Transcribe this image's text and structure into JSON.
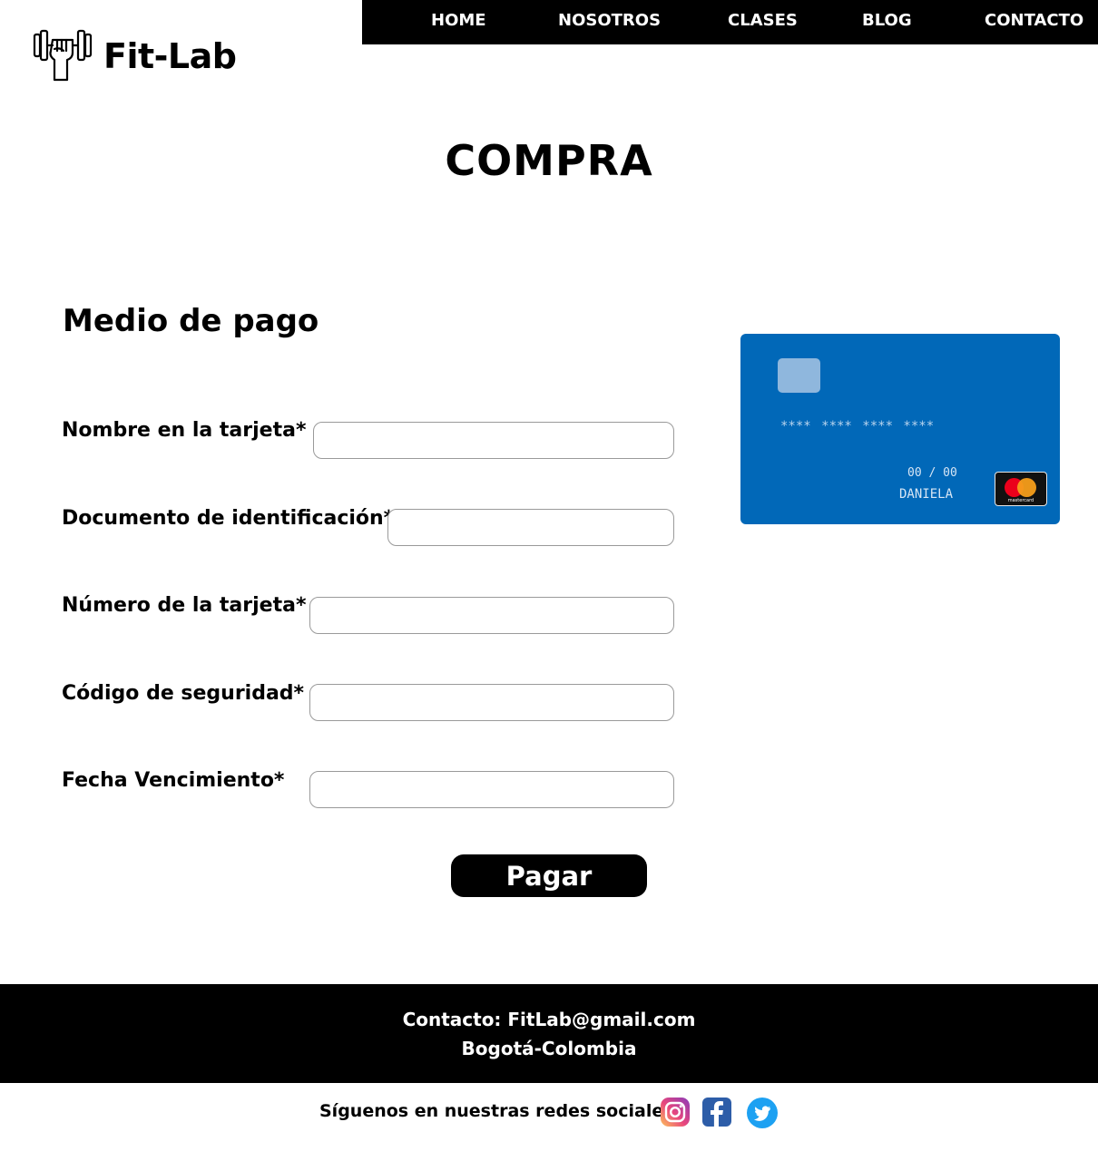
{
  "brand": {
    "name": "Fit-Lab",
    "logo_icon": "dumbbell-hand-icon"
  },
  "nav": {
    "items": [
      {
        "label": "HOME"
      },
      {
        "label": "NOSOTROS"
      },
      {
        "label": "CLASES"
      },
      {
        "label": "BLOG"
      },
      {
        "label": "CONTACTO"
      }
    ]
  },
  "page": {
    "title": "COMPRA"
  },
  "payment": {
    "section_title": "Medio de pago",
    "fields": [
      {
        "label": "Nombre en la tarjeta*",
        "value": "",
        "placeholder": ""
      },
      {
        "label": "Documento de identificación*",
        "value": "",
        "placeholder": ""
      },
      {
        "label": "Número de la tarjeta*",
        "value": "",
        "placeholder": ""
      },
      {
        "label": "Código de seguridad*",
        "value": "",
        "placeholder": ""
      },
      {
        "label": "Fecha Vencimiento*",
        "value": "",
        "placeholder": ""
      }
    ],
    "submit_label": "Pagar"
  },
  "card": {
    "number": "**** **** **** ****",
    "expiry": "00 / 00",
    "holder": "DANIELA",
    "brand_text": "mastercard",
    "color": "#0168b8"
  },
  "footer": {
    "contact": "Contacto: FitLab@gmail.com",
    "location": "Bogotá-Colombia",
    "social_text": "Síguenos en nuestras redes sociales",
    "social_icons": [
      "instagram-icon",
      "facebook-icon",
      "twitter-icon"
    ]
  },
  "colors": {
    "nav_bg": "#000000",
    "footer_bg": "#000000",
    "button_bg": "#000000"
  }
}
